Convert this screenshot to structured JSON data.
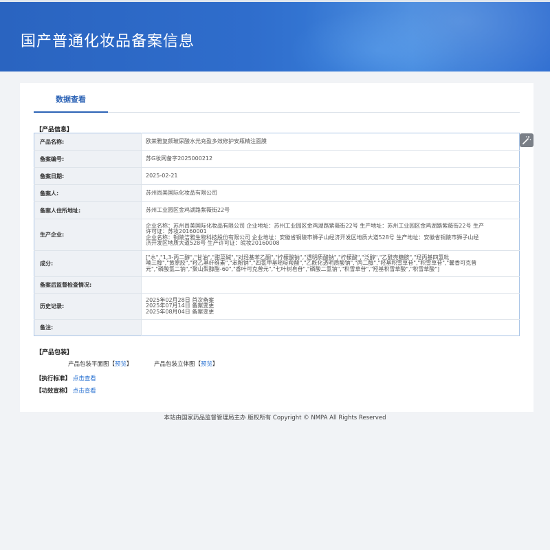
{
  "header": {
    "title": "国产普通化妆品备案信息"
  },
  "tabs": [
    {
      "label": "数据查看"
    }
  ],
  "sections": {
    "product_info": "【产品信息】",
    "packaging": "【产品包装】",
    "standard": "【执行标准】",
    "efficacy": "【功效宣称】"
  },
  "product": {
    "rows": [
      {
        "label": "产品名称:",
        "lines": [
          "欧莱雅复颜玻尿酸水光充盈多效修护安瓶精注面膜"
        ]
      },
      {
        "label": "备案编号:",
        "lines": [
          "苏G妆网备字2025000212"
        ]
      },
      {
        "label": "备案日期:",
        "lines": [
          "2025-02-21"
        ]
      },
      {
        "label": "备案人:",
        "lines": [
          "苏州尚美国际化妆品有限公司"
        ]
      },
      {
        "label": "备案人住所地址:",
        "lines": [
          "苏州工业园区金鸡湖路紫薇街22号"
        ]
      },
      {
        "label": "生产企业:",
        "lines": [
          "企业名称：苏州尚美国际化妆品有限公司 企业地址：苏州工业园区金鸡湖路紫薇街22号 生产地址：苏州工业园区金鸡湖路紫薇街22号 生产",
          "许可证：苏妆20160001",
          "企业名称：铜陵洁雅生物科技股份有限公司 企业地址：安徽省铜陵市狮子山经济开发区地质大道528号 生产地址：安徽省铜陵市狮子山经",
          "济开发区地质大道528号 生产许可证：皖妆20160008"
        ]
      },
      {
        "label": "成分:",
        "lines": [
          "[\"水\",\"1,3-丙二醇\",\"甘油\",\"甜菜碱\",\"对羟基苯乙酮\",\"柠檬酸钠\",\"透明质酸钠\",\"柠檬酸\",\"泛醇\",\"乙酰壳糖胺\",\"羟丙基四氢吡",
          "喃三醇\",\"黄原胶\",\"羟乙基纤维素\",\"苯酚钠\",\"四氢甲基嘧啶羧酸\",\"乙酰化透明质酸钠\",\"丙二醇\",\"羟基积雪草苷\",\"积雪草苷\",\"馨香可克曾",
          "元\",\"磷酸氢二钠\",\"聚山梨醇酯-60\",\"香叶可克曾元\",\"七叶树皂苷\",\"磷酸二氢钠\",\"积雪草苷\",\"羟基积雪草酸\",\"积雪草酸\"]"
        ]
      },
      {
        "label": "备案后监督检查情况:",
        "lines": [
          ""
        ]
      },
      {
        "label": "历史记录:",
        "lines": [
          "2025年02月28日 首次备案",
          "2025年07月14日 备案变更",
          "2025年08月04日 备案变更"
        ]
      },
      {
        "label": "备注:",
        "lines": [
          ""
        ]
      }
    ]
  },
  "packaging": {
    "flat_label": "产品包装平面图",
    "stereo_label": "产品包装立体图",
    "bracket_open": "【",
    "bracket_close": "】",
    "preview": "预览"
  },
  "links": {
    "click_to_view": "点击查看"
  },
  "footer": {
    "text": "本站由国家药品监督管理局主办 版权所有 Copyright © NMPA All Rights Reserved"
  },
  "icons": {
    "tool": "magic-wand-icon"
  },
  "colors": {
    "header_blue": "#2f6dcc",
    "tab_blue": "#2b62b5",
    "link_blue": "#2b73d2",
    "table_border": "#a9c4e6"
  }
}
